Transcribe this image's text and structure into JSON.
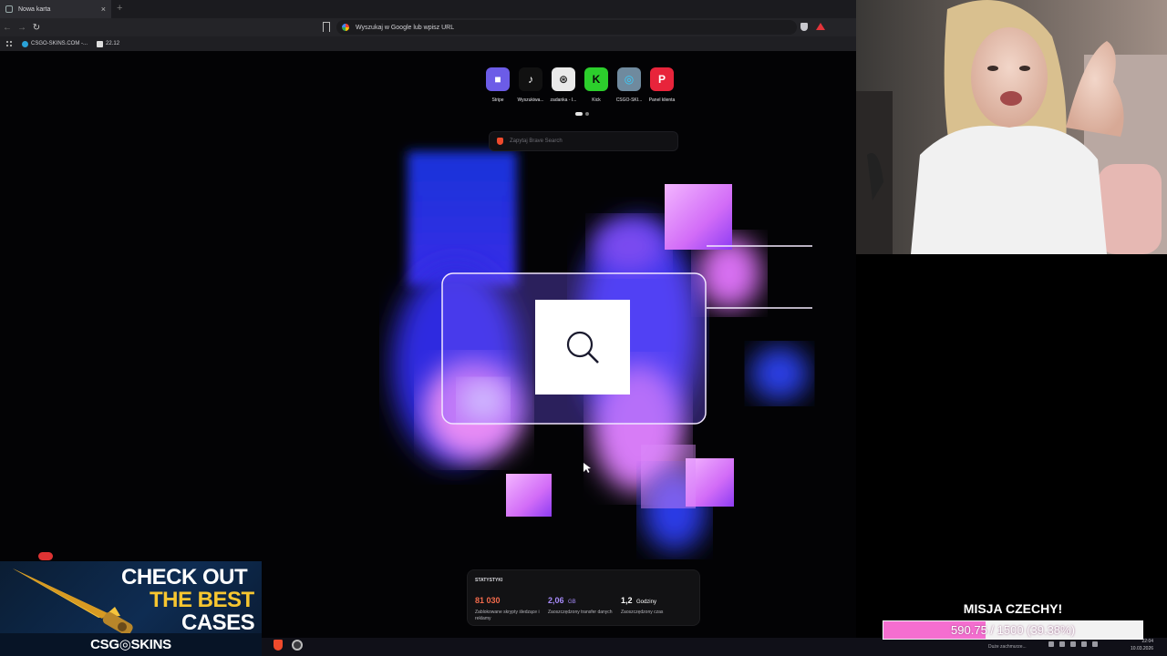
{
  "browser": {
    "tab": {
      "title": "Nowa karta",
      "close_label": "×",
      "new_tab_label": "+"
    },
    "toolbar": {
      "back_label": "←",
      "forward_label": "→",
      "reload_label": "↻",
      "url_placeholder": "Wyszukaj w Google lub wpisz URL"
    },
    "bookmarks": [
      {
        "label": "CSGO-SKINS.COM -...",
        "icon": "csgo-skins-icon"
      },
      {
        "label": "22.12",
        "icon": "page-icon"
      }
    ]
  },
  "new_tab": {
    "shortcuts": [
      {
        "label": "Stripe",
        "icon": "stripe-icon",
        "bg": "#6c5ce7",
        "glyph": "■"
      },
      {
        "label": "Wyszukiwa...",
        "icon": "tiktok-icon",
        "bg": "#111111",
        "glyph": "♪"
      },
      {
        "label": "zadanka - I...",
        "icon": "openai-icon",
        "bg": "#e9e9e9",
        "glyph": "⊛"
      },
      {
        "label": "Kick",
        "icon": "kick-icon",
        "bg": "#2ccf2c",
        "glyph": "K"
      },
      {
        "label": "CSGO-SKI...",
        "icon": "csgo-skins-icon",
        "bg": "#6f8a9e",
        "glyph": "◎"
      },
      {
        "label": "Panel klienta",
        "icon": "panel-icon",
        "bg": "#e8243b",
        "glyph": "P"
      }
    ],
    "search_placeholder": "Zapytaj Brave Search",
    "stats": {
      "title": "STATYSTYKI",
      "items": [
        {
          "value": "81 030",
          "unit": "",
          "desc": "Zablokowane skrypty śledzące i reklamy",
          "color": "#f26a4b"
        },
        {
          "value": "2,06",
          "unit": "GB",
          "desc": "Zaoszczędzony transfer danych",
          "color": "#a78bfa"
        },
        {
          "value": "1,2",
          "unit": "Godziny",
          "desc": "Zaoszczędzony czas",
          "color": "#ffffff"
        }
      ]
    }
  },
  "ad": {
    "line1": "CHECK OUT",
    "line2": "THE BEST",
    "line3": "CASES",
    "brand": "CSG◎SKINS"
  },
  "mission": {
    "title": "MISJA CZECHY!",
    "progress_text": "590.75 / 1500 (39.38%)",
    "progress_fraction": 0.3938,
    "fill_color": "#f56ed0"
  },
  "taskbar": {
    "weather": "Duże zachmurze...",
    "time": "22:04",
    "date": "10.03.2026"
  }
}
